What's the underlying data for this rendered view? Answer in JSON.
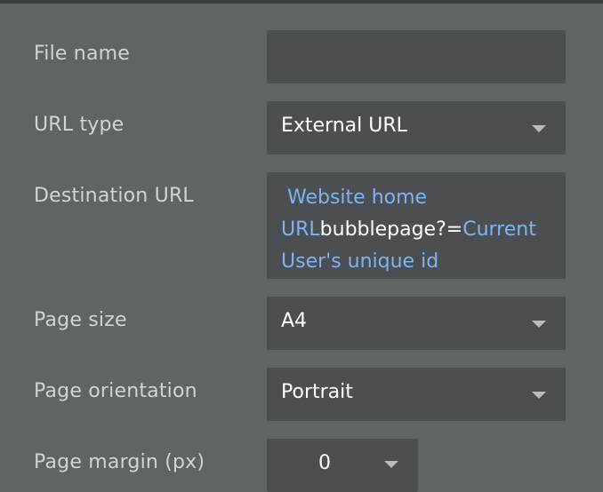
{
  "fields": {
    "file_name": {
      "label": "File name",
      "value": ""
    },
    "url_type": {
      "label": "URL type",
      "value": "External URL"
    },
    "destination_url": {
      "label": "Destination URL",
      "parts": {
        "dyn1": "Website home URL",
        "static": "bubblepage?=",
        "dyn2": "Current User's unique id"
      }
    },
    "page_size": {
      "label": "Page size",
      "value": "A4"
    },
    "page_orientation": {
      "label": "Page orientation",
      "value": "Portrait"
    },
    "page_margin": {
      "label": "Page margin (px)",
      "value": "0"
    }
  },
  "icons": {
    "dropdown": "chevron-down-icon"
  },
  "colors": {
    "background": "#5f6466",
    "field": "#4b4f51",
    "label": "#d1d4d6",
    "value": "#ffffff",
    "dynamic": "#7db3f2"
  }
}
